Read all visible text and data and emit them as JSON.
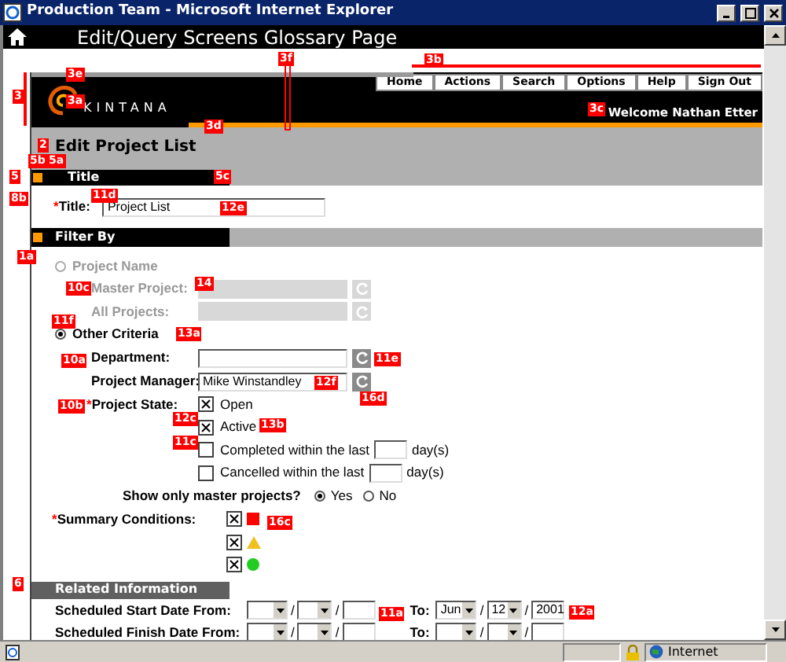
{
  "window": {
    "title": "Production Team - Microsoft Internet Explorer"
  },
  "page_title": "Edit/Query Screens Glossary Page",
  "brand": "KINTANA",
  "nav": [
    "Home",
    "Actions",
    "Search",
    "Options",
    "Help",
    "Sign Out"
  ],
  "welcome": "Welcome Nathan Etter",
  "heading": "Edit Project List",
  "title_section": {
    "tab": "Title",
    "required_mark": "*",
    "label": "Title:",
    "value": "Project List"
  },
  "filter": {
    "title": "Filter By",
    "project_name": {
      "label": "Project Name",
      "selected": false,
      "disabled": true
    },
    "project_fields": [
      {
        "label": "Master Project:",
        "disabled": true
      },
      {
        "label": "All Projects:",
        "disabled": true
      }
    ],
    "other_criteria": {
      "label": "Other Criteria",
      "selected": true
    },
    "criteria_fields": [
      {
        "label": "Department:",
        "disabled": false
      },
      {
        "label": "Project Manager:",
        "value": "Mike Winstandley",
        "disabled": false
      }
    ],
    "project_state": {
      "required_mark": "*",
      "label": "Project State:",
      "options": [
        {
          "kind": "check",
          "label": "Open",
          "checked": true
        },
        {
          "kind": "check",
          "label": "Active",
          "checked": true
        },
        {
          "kind": "days",
          "label": "Completed within the last",
          "unit": "day(s)",
          "checked": false
        },
        {
          "kind": "days",
          "label": "Cancelled within the last",
          "unit": "day(s)",
          "checked": false
        }
      ]
    },
    "master_only": {
      "label": "Show only master projects?",
      "options": [
        {
          "label": "Yes",
          "selected": true
        },
        {
          "label": "No",
          "selected": false
        }
      ]
    },
    "summary": {
      "required_mark": "*",
      "label": "Summary Conditions:",
      "items": [
        {
          "kind": "flag",
          "color": "#ff0000",
          "checked": true
        },
        {
          "kind": "triangle",
          "color": "#f0c020",
          "checked": true
        },
        {
          "kind": "circle",
          "color": "#22cc22",
          "checked": true
        }
      ]
    }
  },
  "related": {
    "title": "Related Information",
    "rows": [
      {
        "label": "Scheduled Start Date From:",
        "separator": "/",
        "to": "To:",
        "to_month": "Jun",
        "to_day": "12",
        "to_year": "2001"
      },
      {
        "label": "Scheduled Finish Date From:",
        "separator": "/",
        "to": "To:"
      }
    ]
  },
  "status_bar": {
    "zone": "Internet"
  },
  "annotations": [
    {
      "text": "3e"
    },
    {
      "text": "3f"
    },
    {
      "text": "3b"
    },
    {
      "text": "3"
    },
    {
      "text": "3a"
    },
    {
      "text": "3c"
    },
    {
      "text": "3d"
    },
    {
      "text": "2"
    },
    {
      "text": "5"
    },
    {
      "text": "5b"
    },
    {
      "text": "5a"
    },
    {
      "text": "5c"
    },
    {
      "text": "8b"
    },
    {
      "text": "11d"
    },
    {
      "text": "12e"
    },
    {
      "text": "1a"
    },
    {
      "text": "10c"
    },
    {
      "text": "14"
    },
    {
      "text": "11f"
    },
    {
      "text": "13a"
    },
    {
      "text": "10a"
    },
    {
      "text": "11e"
    },
    {
      "text": "12f"
    },
    {
      "text": "16d"
    },
    {
      "text": "10b"
    },
    {
      "text": "12c"
    },
    {
      "text": "13b"
    },
    {
      "text": "11c"
    },
    {
      "text": "16c"
    },
    {
      "text": "6"
    },
    {
      "text": "11a"
    },
    {
      "text": "12a"
    }
  ]
}
